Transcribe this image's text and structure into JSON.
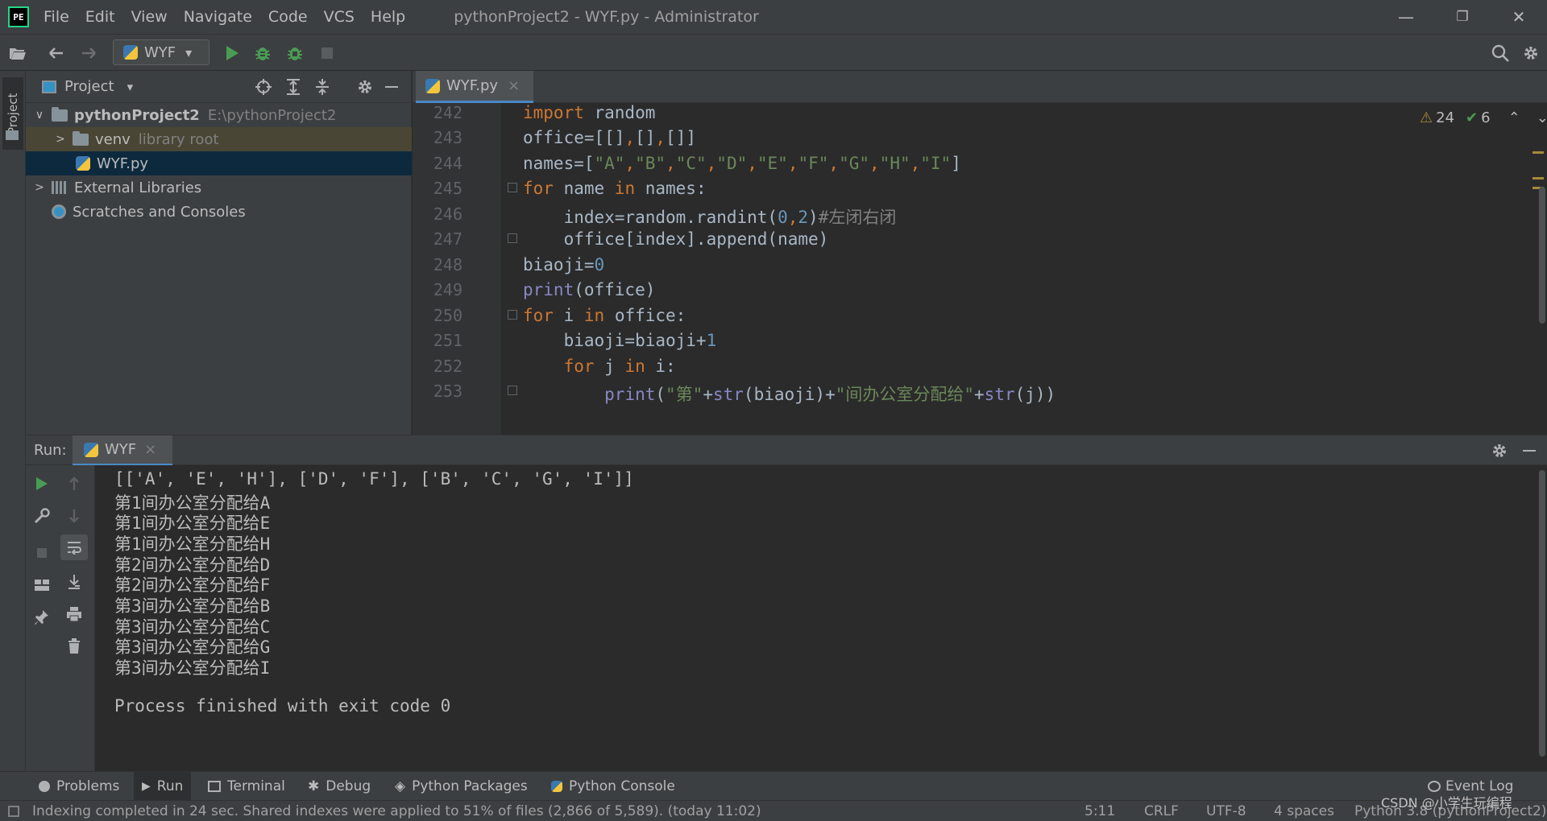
{
  "window": {
    "app_icon_text": "PE",
    "title": "pythonProject2 - WYF.py - Administrator",
    "minimize": "—",
    "restore": "❐",
    "close": "✕"
  },
  "menu": [
    "File",
    "Edit",
    "View",
    "Navigate",
    "Code",
    "VCS",
    "Help"
  ],
  "toolbar": {
    "run_config": "WYF",
    "run_config_arrow": "▾"
  },
  "left_strip": {
    "project_tab": "Project"
  },
  "project_panel": {
    "title": "Project",
    "title_arrow": "▾",
    "tree": [
      {
        "arrow": "∨",
        "label": "pythonProject2",
        "extra": "E:\\pythonProject2"
      },
      {
        "arrow": ">",
        "label": "venv",
        "extra": "library root"
      },
      {
        "arrow": "",
        "label": "WYF.py",
        "extra": ""
      },
      {
        "arrow": ">",
        "label": "External Libraries",
        "extra": ""
      },
      {
        "arrow": "",
        "label": "Scratches and Consoles",
        "extra": ""
      }
    ]
  },
  "editor": {
    "tab_label": "WYF.py",
    "tab_close": "×",
    "warnings": "24",
    "weak_warnings": "6",
    "line_numbers": [
      "242",
      "243",
      "244",
      "245",
      "246",
      "247",
      "248",
      "249",
      "250",
      "251",
      "252",
      "253"
    ]
  },
  "run_panel": {
    "label": "Run:",
    "tab_label": "WYF",
    "tab_close": "×",
    "output": [
      "[['A', 'E', 'H'], ['D', 'F'], ['B', 'C', 'G', 'I']]",
      "第1间办公室分配给A",
      "第1间办公室分配给E",
      "第1间办公室分配给H",
      "第2间办公室分配给D",
      "第2间办公室分配给F",
      "第3间办公室分配给B",
      "第3间办公室分配给C",
      "第3间办公室分配给G",
      "第3间办公室分配给I",
      "",
      "Process finished with exit code 0"
    ]
  },
  "bottom_tabs": [
    "Problems",
    "Run",
    "Terminal",
    "Debug",
    "Python Packages",
    "Python Console"
  ],
  "event_log": "Event Log",
  "status": {
    "message": "Indexing completed in 24 sec. Shared indexes were applied to 51% of files (2,866 of 5,589). (today 11:02)",
    "position": "5:11",
    "line_sep": "CRLF",
    "encoding": "UTF-8",
    "indent": "4 spaces",
    "interpreter": "Python 3.8 (pythonProject2)"
  },
  "watermark": "CSDN @小学生玩编程",
  "colors": {
    "accent": "#4a88c7",
    "keyword": "#cc7832",
    "string": "#6a8759",
    "number": "#6897bb",
    "run_green": "#499c54",
    "selection": "#0d293e"
  }
}
